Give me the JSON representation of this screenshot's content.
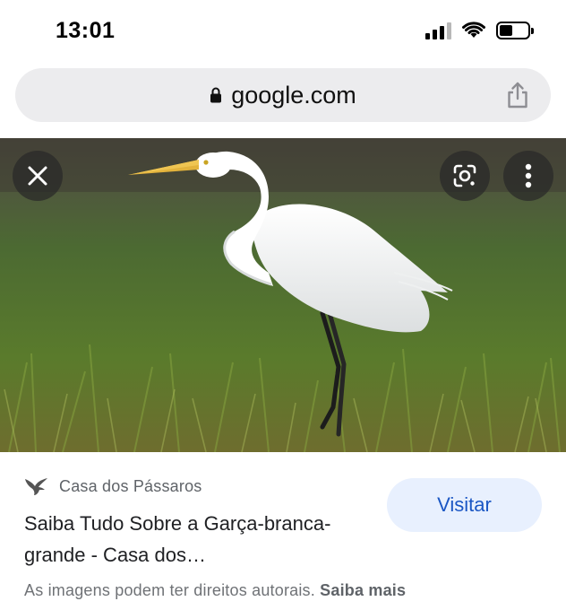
{
  "status_bar": {
    "time": "13:01"
  },
  "browser": {
    "url": "google.com"
  },
  "image_viewer": {
    "image_subject": "great-egret-in-grass",
    "icons": {
      "close": "close-icon",
      "lens": "lens-icon",
      "more": "more-vert-icon"
    }
  },
  "result": {
    "source_name": "Casa dos Pássaros",
    "title": "Saiba Tudo Sobre a Garça-branca-grande - Casa dos…",
    "visit_label": "Visitar"
  },
  "footer": {
    "copyright_text": "As imagens podem ter direitos autorais.",
    "learn_more_label": "Saiba mais"
  },
  "colors": {
    "accent_button_bg": "#e8f0fe",
    "accent_button_text": "#1a56c4",
    "url_bar_bg": "#ececee"
  }
}
